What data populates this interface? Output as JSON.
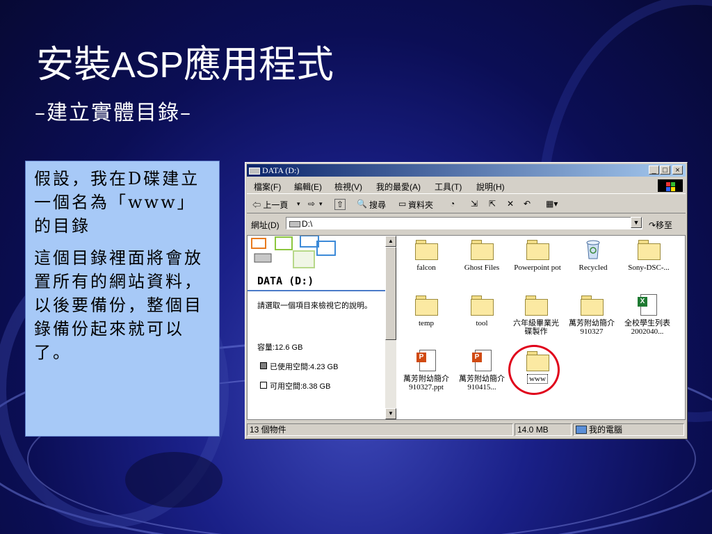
{
  "slide": {
    "title_pre": "安裝",
    "title_latin": "ASP",
    "title_post": "應用程式",
    "subtitle": "–建立實體目錄–",
    "paragraphs": [
      "假設，我在D碟建立一個名為「www」的目錄",
      "這個目錄裡面將會放置所有的網站資料，以後要備份，整個目錄備份起來就可以了。"
    ]
  },
  "explorer": {
    "title": "DATA (D:)",
    "controls": {
      "minimize": "_",
      "maximize": "□",
      "close": "×"
    },
    "menu": [
      "檔案(F)",
      "編輯(E)",
      "檢視(V)",
      "我的最愛(A)",
      "工具(T)",
      "說明(H)"
    ],
    "toolbar": {
      "back": "⇦ 上一頁",
      "back_drop": "▾",
      "forward": "⇨",
      "forward_drop": "▾",
      "up": "⇧",
      "search": "搜尋",
      "folders": "資料夾",
      "history": "◔",
      "move_to": "⇲",
      "copy_to": "⇱",
      "delete": "✕",
      "undo": "↶",
      "views": "▦▾"
    },
    "address": {
      "label": "網址(D)",
      "value": "D:\\",
      "dropdown": "▼",
      "go": "↷移至"
    },
    "left_pane": {
      "heading": "DATA (D:)",
      "description": "請選取一個項目來檢視它的說明。",
      "capacity": "容量:12.6 GB",
      "used": "已使用空間:4.23 GB",
      "free": "可用空間:8.38 GB"
    },
    "scroll": {
      "up": "▲",
      "down": "▼"
    },
    "files": [
      {
        "name": "falcon",
        "type": "folder"
      },
      {
        "name": "Ghost Files",
        "type": "folder"
      },
      {
        "name": "Powerpoint pot",
        "type": "folder"
      },
      {
        "name": "Recycled",
        "type": "recycle"
      },
      {
        "name": "Sony-DSC-...",
        "type": "folder"
      },
      {
        "name": "temp",
        "type": "folder"
      },
      {
        "name": "tool",
        "type": "folder"
      },
      {
        "name": "六年級畢業光碟製作",
        "type": "folder"
      },
      {
        "name": "萬芳附幼簡介910327",
        "type": "folder"
      },
      {
        "name": "全校學生列表2002040...",
        "type": "excel"
      },
      {
        "name": "萬芳附幼簡介 910327.ppt",
        "type": "ppt"
      },
      {
        "name": "萬芳附幼簡介 910415...",
        "type": "ppt"
      },
      {
        "name": "www",
        "type": "folder"
      }
    ],
    "status": {
      "count": "13 個物件",
      "size": "14.0 MB",
      "location": "我的電腦"
    }
  }
}
